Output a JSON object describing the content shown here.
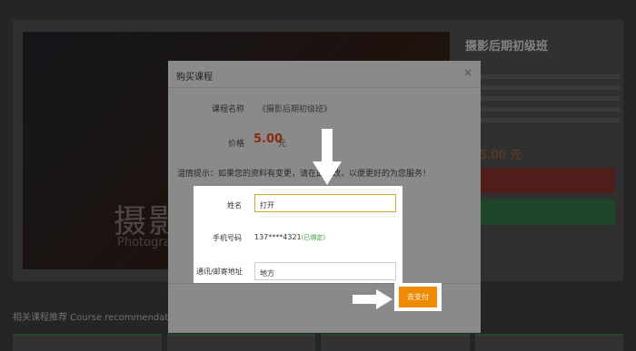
{
  "background": {
    "hero_title": "摄影",
    "hero_subtitle": "Photograp",
    "course_title": "摄影后期初级班",
    "price_hint": "5.00 元",
    "related_heading": "相关课程推荐 Course recommendati"
  },
  "modal": {
    "title": "购买课程",
    "close_label": "×",
    "course_name_label": "课程名称",
    "course_name_value": "《摄影后期初级班》",
    "price_label": "价格",
    "price_value": "5.00",
    "price_unit": "元",
    "notice": "温情提示：如果您的资料有变更，请在此修改，以便更好的为您服务！"
  },
  "form": {
    "name_label": "姓名",
    "name_value": "打开",
    "phone_label": "手机号码",
    "phone_value": "137****4321",
    "phone_status": "(已绑定)",
    "address_label": "通讯/邮寄地址",
    "address_value": "地方"
  },
  "actions": {
    "pay_label": "去支付"
  }
}
